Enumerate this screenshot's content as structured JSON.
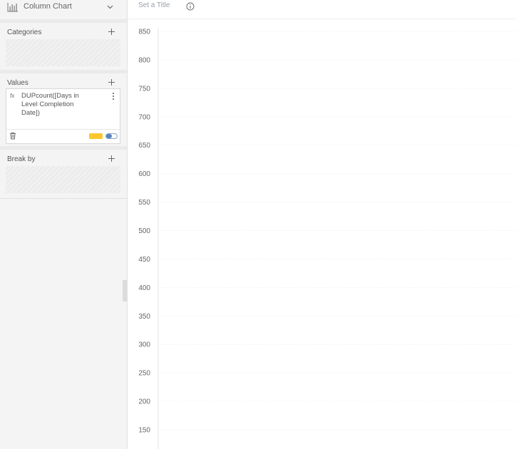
{
  "chart_type": {
    "label": "Column Chart",
    "icon": "bar-chart-icon"
  },
  "sections": {
    "categories": {
      "title": "Categories"
    },
    "values": {
      "title": "Values",
      "item": {
        "fx": "fx",
        "label": "DUPcount([Days in Level Completion Date])",
        "color": "#fcc72c"
      }
    },
    "break_by": {
      "title": "Break by"
    }
  },
  "chart": {
    "title_placeholder": "Set a Title"
  },
  "chart_data": {
    "type": "bar",
    "title": "",
    "categories": [],
    "series": [],
    "xlabel": "",
    "ylabel": "",
    "ylim": [
      150,
      850
    ],
    "yticks": [
      850,
      800,
      750,
      700,
      650,
      600,
      550,
      500,
      450,
      400,
      350,
      300,
      250,
      200,
      150
    ],
    "grid": true,
    "legend": "none"
  },
  "colors": {
    "panel_bg": "#f4f4f4",
    "accent": "#5a85b8",
    "grid": "#eeeeee"
  }
}
